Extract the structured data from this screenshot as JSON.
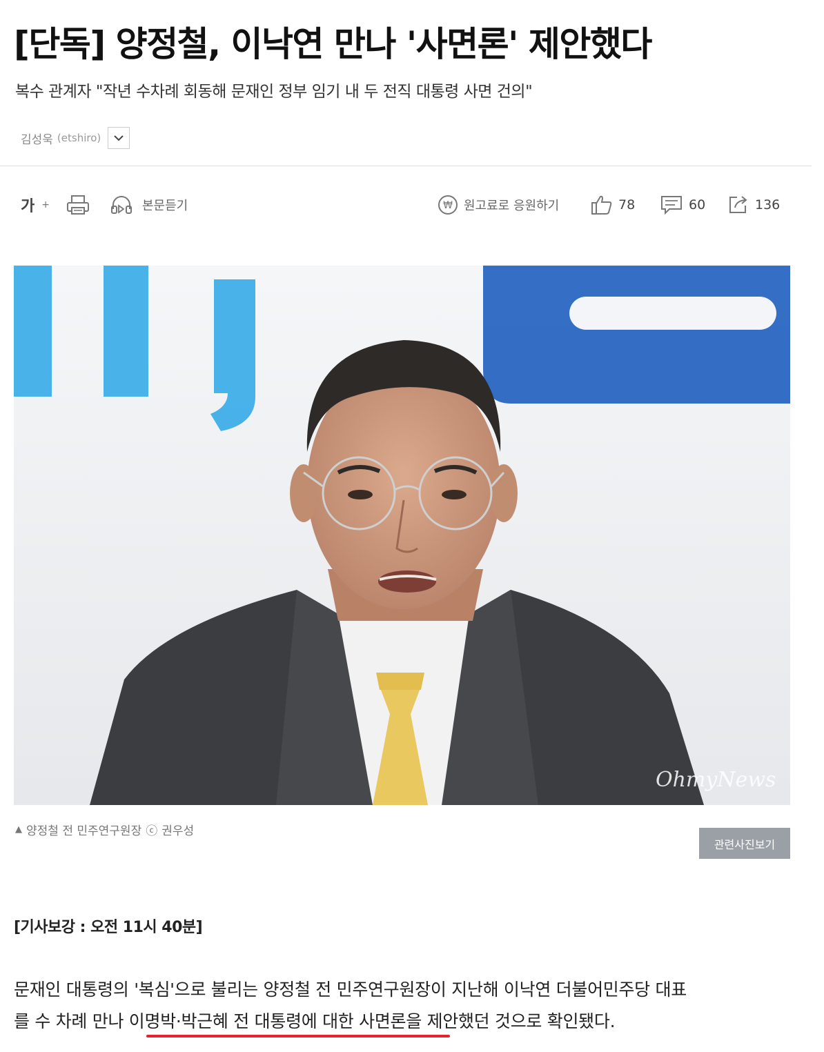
{
  "article": {
    "headline": "[단독] 양정철, 이낙연 만나 '사면론' 제안했다",
    "subheadline": "복수 관계자 \"작년 수차례 회동해 문재인 정부 임기 내 두 전직 대통령 사면 건의\"",
    "author_name": "김성욱",
    "author_id": "(etshiro)"
  },
  "toolbar": {
    "font_size_label": "가",
    "font_size_plus": "+",
    "listen_label": "본문듣기",
    "donate_label": "원고료로 응원하기",
    "likes": "78",
    "comments": "60",
    "shares": "136"
  },
  "photo": {
    "watermark": "OhmyNews",
    "caption_marker": "▲",
    "caption": "양정철 전 민주연구원장",
    "copyright_symbol": "ⓒ",
    "photographer": "권우성",
    "related_button": "관련사진보기"
  },
  "body": {
    "update_note": "[기사보강 : 오전 11시 40분]",
    "paragraph_line1": "문재인 대통령의 '복심'으로 불리는 양정철 전 민주연구원장이 지난해 이낙연 더불어민주당 대표",
    "paragraph_line2": "를 수 차례 만나 이명박·박근혜 전 대통령에 대한 사면론을 제안했던 것으로 확인됐다."
  },
  "colors": {
    "highlight_underline": "#e8212e",
    "button_bg": "#9aa0a6",
    "photo_accent_blue": "#2aa6e6",
    "photo_accent_navy": "#1f5fbf"
  }
}
